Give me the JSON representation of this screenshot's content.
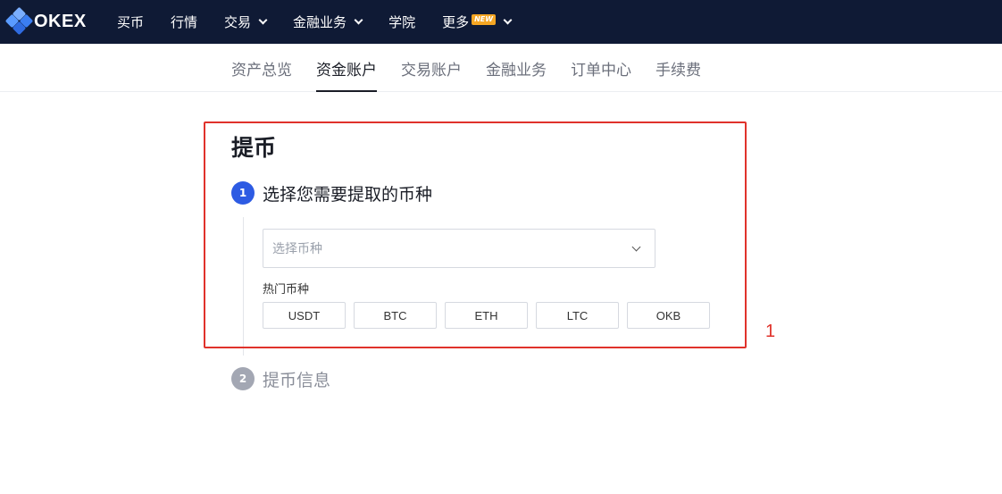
{
  "brand": {
    "name": "OKEX"
  },
  "nav": {
    "items": [
      {
        "label": "买币",
        "dropdown": false
      },
      {
        "label": "行情",
        "dropdown": false
      },
      {
        "label": "交易",
        "dropdown": true
      },
      {
        "label": "金融业务",
        "dropdown": true
      },
      {
        "label": "学院",
        "dropdown": false
      },
      {
        "label": "更多",
        "dropdown": true,
        "badge": "NEW"
      }
    ]
  },
  "subnav": {
    "items": [
      {
        "label": "资产总览",
        "active": false
      },
      {
        "label": "资金账户",
        "active": true
      },
      {
        "label": "交易账户",
        "active": false
      },
      {
        "label": "金融业务",
        "active": false
      },
      {
        "label": "订单中心",
        "active": false
      },
      {
        "label": "手续费",
        "active": false
      }
    ]
  },
  "main": {
    "title": "提币",
    "steps": [
      {
        "number": "1",
        "label": "选择您需要提取的币种",
        "status": "active"
      },
      {
        "number": "2",
        "label": "提币信息",
        "status": "inactive"
      }
    ],
    "coin_select": {
      "placeholder": "选择币种"
    },
    "hot_coins": {
      "label": "热门币种",
      "coins": [
        "USDT",
        "BTC",
        "ETH",
        "LTC",
        "OKB"
      ]
    }
  },
  "annotation": {
    "label": "1"
  },
  "colors": {
    "topbar_bg": "#0f1a35",
    "step_active": "#2d5be3",
    "step_inactive": "#a3a7b3",
    "highlight": "#e0322b",
    "badge": "#f5a623"
  }
}
